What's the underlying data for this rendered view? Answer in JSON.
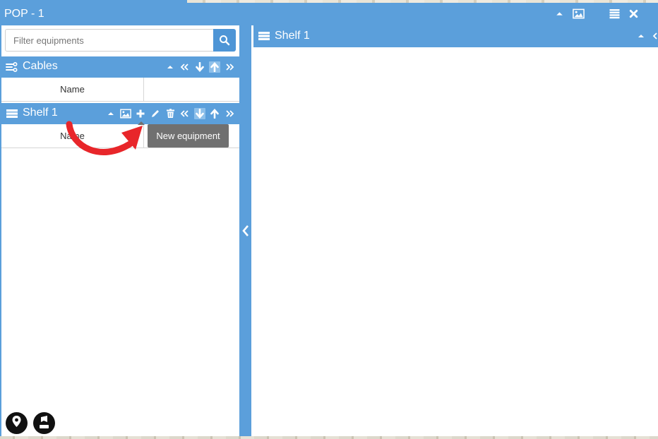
{
  "window": {
    "title": "POP - 1",
    "icons": [
      "caret-up-icon",
      "image-icon",
      "list-icon",
      "close-icon"
    ]
  },
  "search": {
    "placeholder": "Filter equipments",
    "value": ""
  },
  "cables": {
    "title": "Cables",
    "tools": [
      "caret-up-icon",
      "double-chevron-left-icon",
      "arrow-down-icon",
      "arrow-up-icon",
      "double-chevron-right-icon"
    ],
    "columns": [
      "Name",
      ""
    ]
  },
  "shelf": {
    "title": "Shelf 1",
    "tools": [
      "caret-up-icon",
      "image-icon",
      "plus-icon",
      "pencil-icon",
      "trash-icon",
      "double-chevron-left-icon",
      "arrow-down-icon",
      "arrow-up-icon",
      "double-chevron-right-icon"
    ],
    "columns": [
      "Name",
      ""
    ]
  },
  "tooltip": {
    "text": "New equipment"
  },
  "right_panel": {
    "title": "Shelf 1"
  },
  "colors": {
    "brand": "#5b9fdb",
    "tooltip": "#707070",
    "annotation": "#e8262a"
  }
}
